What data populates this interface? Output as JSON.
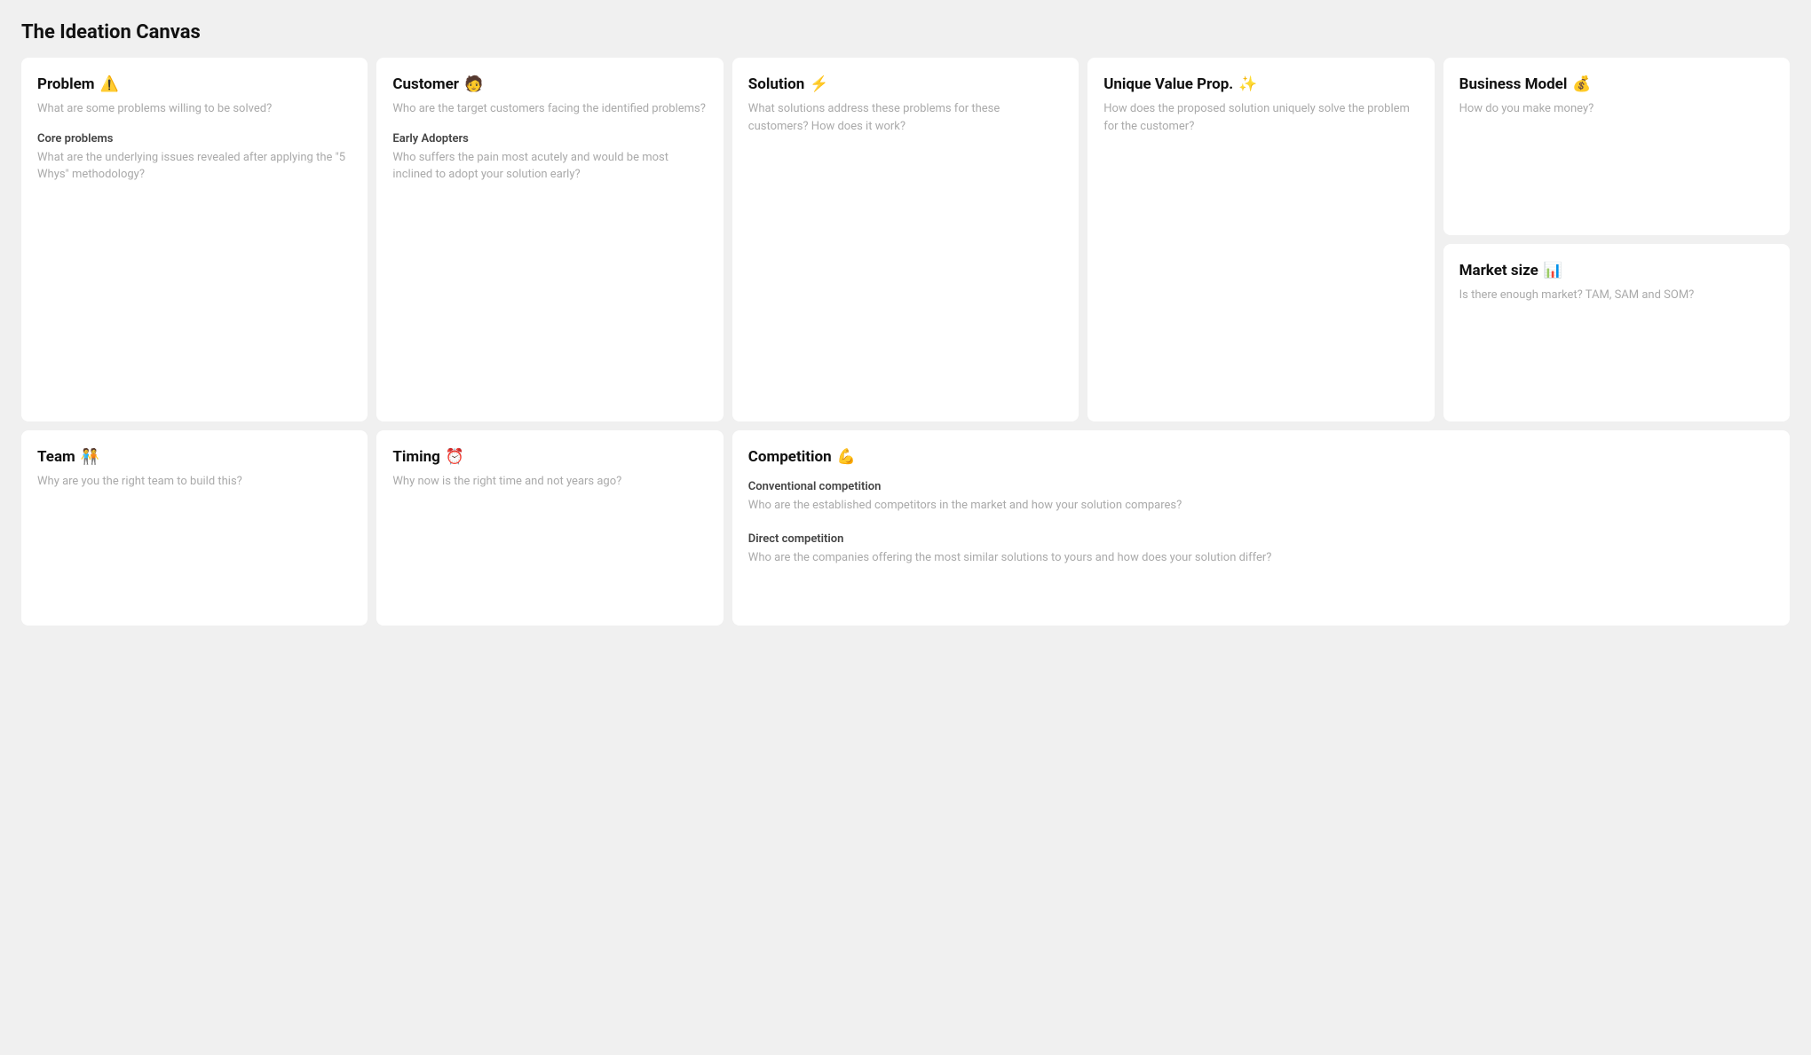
{
  "page": {
    "title": "The Ideation Canvas"
  },
  "cards": {
    "problem": {
      "title": "Problem",
      "icon": "⚠️",
      "description": "What are some problems willing to be solved?",
      "sub1_title": "Core problems",
      "sub1_description": "What are the underlying issues revealed after applying the \"5 Whys\" methodology?"
    },
    "customer": {
      "title": "Customer",
      "icon": "🧑",
      "description": "Who are the target customers facing the identified problems?",
      "sub1_title": "Early Adopters",
      "sub1_description": "Who suffers the pain most acutely and would be most inclined to adopt your solution early?"
    },
    "solution": {
      "title": "Solution",
      "icon": "⚡",
      "description": "What solutions address these problems for these customers? How does it work?"
    },
    "uvp": {
      "title": "Unique Value Prop.",
      "icon": "✨",
      "description": "How does the proposed solution uniquely solve the problem for the customer?"
    },
    "business_model": {
      "title": "Business Model",
      "icon": "💰",
      "description": "How do you make money?"
    },
    "market_size": {
      "title": "Market size",
      "icon": "📊",
      "description": "Is there enough market? TAM, SAM and SOM?"
    },
    "team": {
      "title": "Team",
      "icon": "🧑‍🤝‍🧑",
      "description": "Why are you the right team to build this?"
    },
    "timing": {
      "title": "Timing",
      "icon": "⏰",
      "description": "Why now is the right time and not years ago?"
    },
    "competition": {
      "title": "Competition",
      "icon": "💪",
      "sub1_title": "Conventional competition",
      "sub1_description": "Who are the established competitors in the market and how your solution compares?",
      "sub2_title": "Direct competition",
      "sub2_description": "Who are the companies offering the most similar solutions to yours and how does your solution differ?"
    }
  }
}
